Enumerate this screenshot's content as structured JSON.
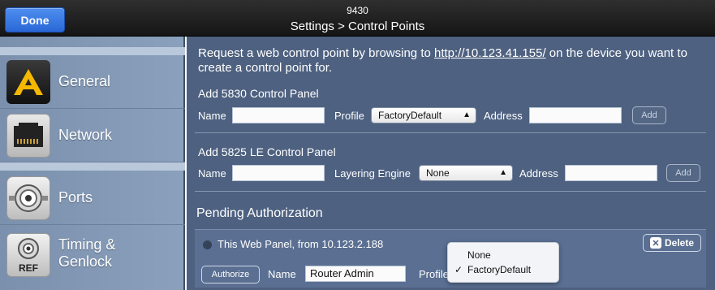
{
  "header": {
    "done_label": "Done",
    "subtitle": "9430",
    "title": "Settings > Control Points"
  },
  "sidebar": {
    "items": [
      {
        "label": "General",
        "icon": "general-a-icon"
      },
      {
        "label": "Network",
        "icon": "network-port-icon"
      },
      {
        "label": "Ports",
        "icon": "bnc-port-icon"
      },
      {
        "label": "Timing &",
        "label2": "Genlock",
        "icon": "ref-connector-icon",
        "badge": "REF"
      }
    ]
  },
  "main": {
    "request_text_before": "Request a web control point by browsing to ",
    "request_link": "http://10.123.41.155/",
    "request_text_after": " on the device you want to create a control point for.",
    "panel5830": {
      "title": "Add 5830 Control Panel",
      "name_label": "Name",
      "name_value": "",
      "profile_label": "Profile",
      "profile_value": "FactoryDefault",
      "address_label": "Address",
      "address_value": "",
      "add_label": "Add"
    },
    "panel5825": {
      "title": "Add 5825 LE Control Panel",
      "name_label": "Name",
      "name_value": "",
      "layering_label": "Layering Engine",
      "layering_value": "None",
      "address_label": "Address",
      "address_value": "",
      "add_label": "Add"
    },
    "pending": {
      "title": "Pending Authorization",
      "entry_text": "This Web Panel, from 10.123.2.188",
      "delete_label": "Delete",
      "authorize_label": "Authorize",
      "name_label": "Name",
      "name_value": "Router Admin",
      "profile_label": "Profile"
    },
    "profile_popup": {
      "options": [
        "None",
        "FactoryDefault"
      ],
      "selected": "FactoryDefault",
      "check_mark": "✓"
    }
  },
  "colors": {
    "accent": "#2a67d6",
    "main_bg": "#4e6180",
    "sidebar_bg": "#8aa0bc",
    "general_icon_yellow": "#f5b800"
  }
}
